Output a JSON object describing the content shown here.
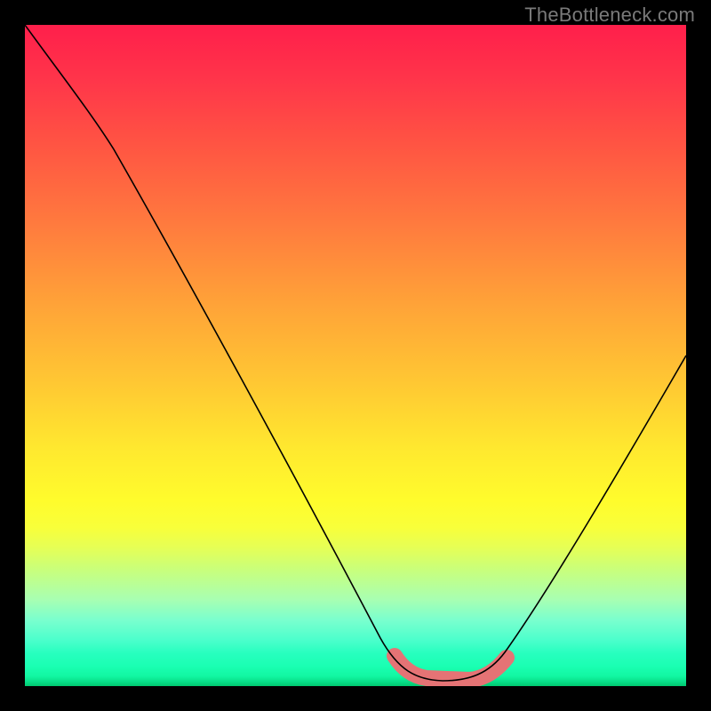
{
  "watermark": "TheBottleneck.com",
  "colors": {
    "frame": "#000000",
    "curve": "#000000",
    "highlight": "#e57375",
    "watermark": "#7a7a7a"
  },
  "chart_data": {
    "type": "line",
    "title": "",
    "xlabel": "",
    "ylabel": "",
    "xlim": [
      0,
      100
    ],
    "ylim": [
      0,
      100
    ],
    "grid": false,
    "legend": false,
    "annotations": [
      "TheBottleneck.com"
    ],
    "series": [
      {
        "name": "bottleneck-curve",
        "x": [
          0,
          5,
          10,
          15,
          20,
          25,
          30,
          35,
          40,
          45,
          50,
          55,
          60,
          63,
          67,
          72,
          78,
          85,
          92,
          100
        ],
        "y": [
          100,
          92,
          84,
          76,
          68,
          60,
          51,
          42,
          33,
          24,
          15,
          8,
          3,
          1,
          1,
          3,
          9,
          19,
          33,
          50
        ]
      },
      {
        "name": "highlight-band",
        "x": [
          56,
          58,
          62,
          66,
          70,
          73
        ],
        "y": [
          4,
          2,
          1,
          1,
          2,
          4
        ]
      }
    ],
    "gradient_stops": [
      {
        "pos": 0,
        "color": "#ff1f4b"
      },
      {
        "pos": 50,
        "color": "#ffc733"
      },
      {
        "pos": 75,
        "color": "#fffc2c"
      },
      {
        "pos": 100,
        "color": "#00c86f"
      }
    ]
  }
}
